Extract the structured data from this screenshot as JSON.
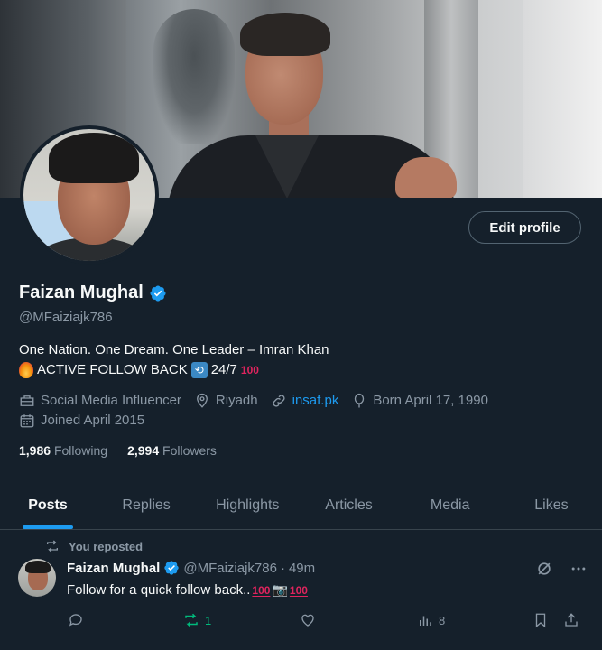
{
  "profile": {
    "edit_button": "Edit profile",
    "name": "Faizan Mughal",
    "handle": "@MFaiziajk786",
    "bio_line1": "One Nation. One Dream. One Leader – Imran Khan",
    "bio_line2_text": "ACTIVE FOLLOW BACK",
    "bio_line2_suffix": "24/7",
    "hundred": "100",
    "category": "Social Media Influencer",
    "location": "Riyadh",
    "website": "insaf.pk",
    "birthday": "Born April 17, 1990",
    "joined": "Joined April 2015",
    "following_count": "1,986",
    "following_label": "Following",
    "followers_count": "2,994",
    "followers_label": "Followers"
  },
  "tabs": [
    {
      "label": "Posts",
      "active": true
    },
    {
      "label": "Replies"
    },
    {
      "label": "Highlights"
    },
    {
      "label": "Articles"
    },
    {
      "label": "Media"
    },
    {
      "label": "Likes"
    }
  ],
  "post": {
    "repost_label": "You reposted",
    "author_name": "Faizan Mughal",
    "author_handle": "@MFaiziajk786",
    "separator": "·",
    "time": "49m",
    "text": "Follow for a quick follow back..",
    "repost_count": "1",
    "views_count": "8"
  },
  "colors": {
    "background": "#15202b",
    "accent": "#1d9bf0",
    "muted": "#8b98a5",
    "repost_green": "#00ba7c"
  },
  "icons": [
    "verified-badge-icon",
    "briefcase-icon",
    "location-pin-icon",
    "link-icon",
    "balloon-icon",
    "calendar-icon",
    "repost-icon",
    "grok-icon",
    "more-icon",
    "reply-icon",
    "like-icon",
    "views-icon",
    "bookmark-icon",
    "share-icon"
  ]
}
